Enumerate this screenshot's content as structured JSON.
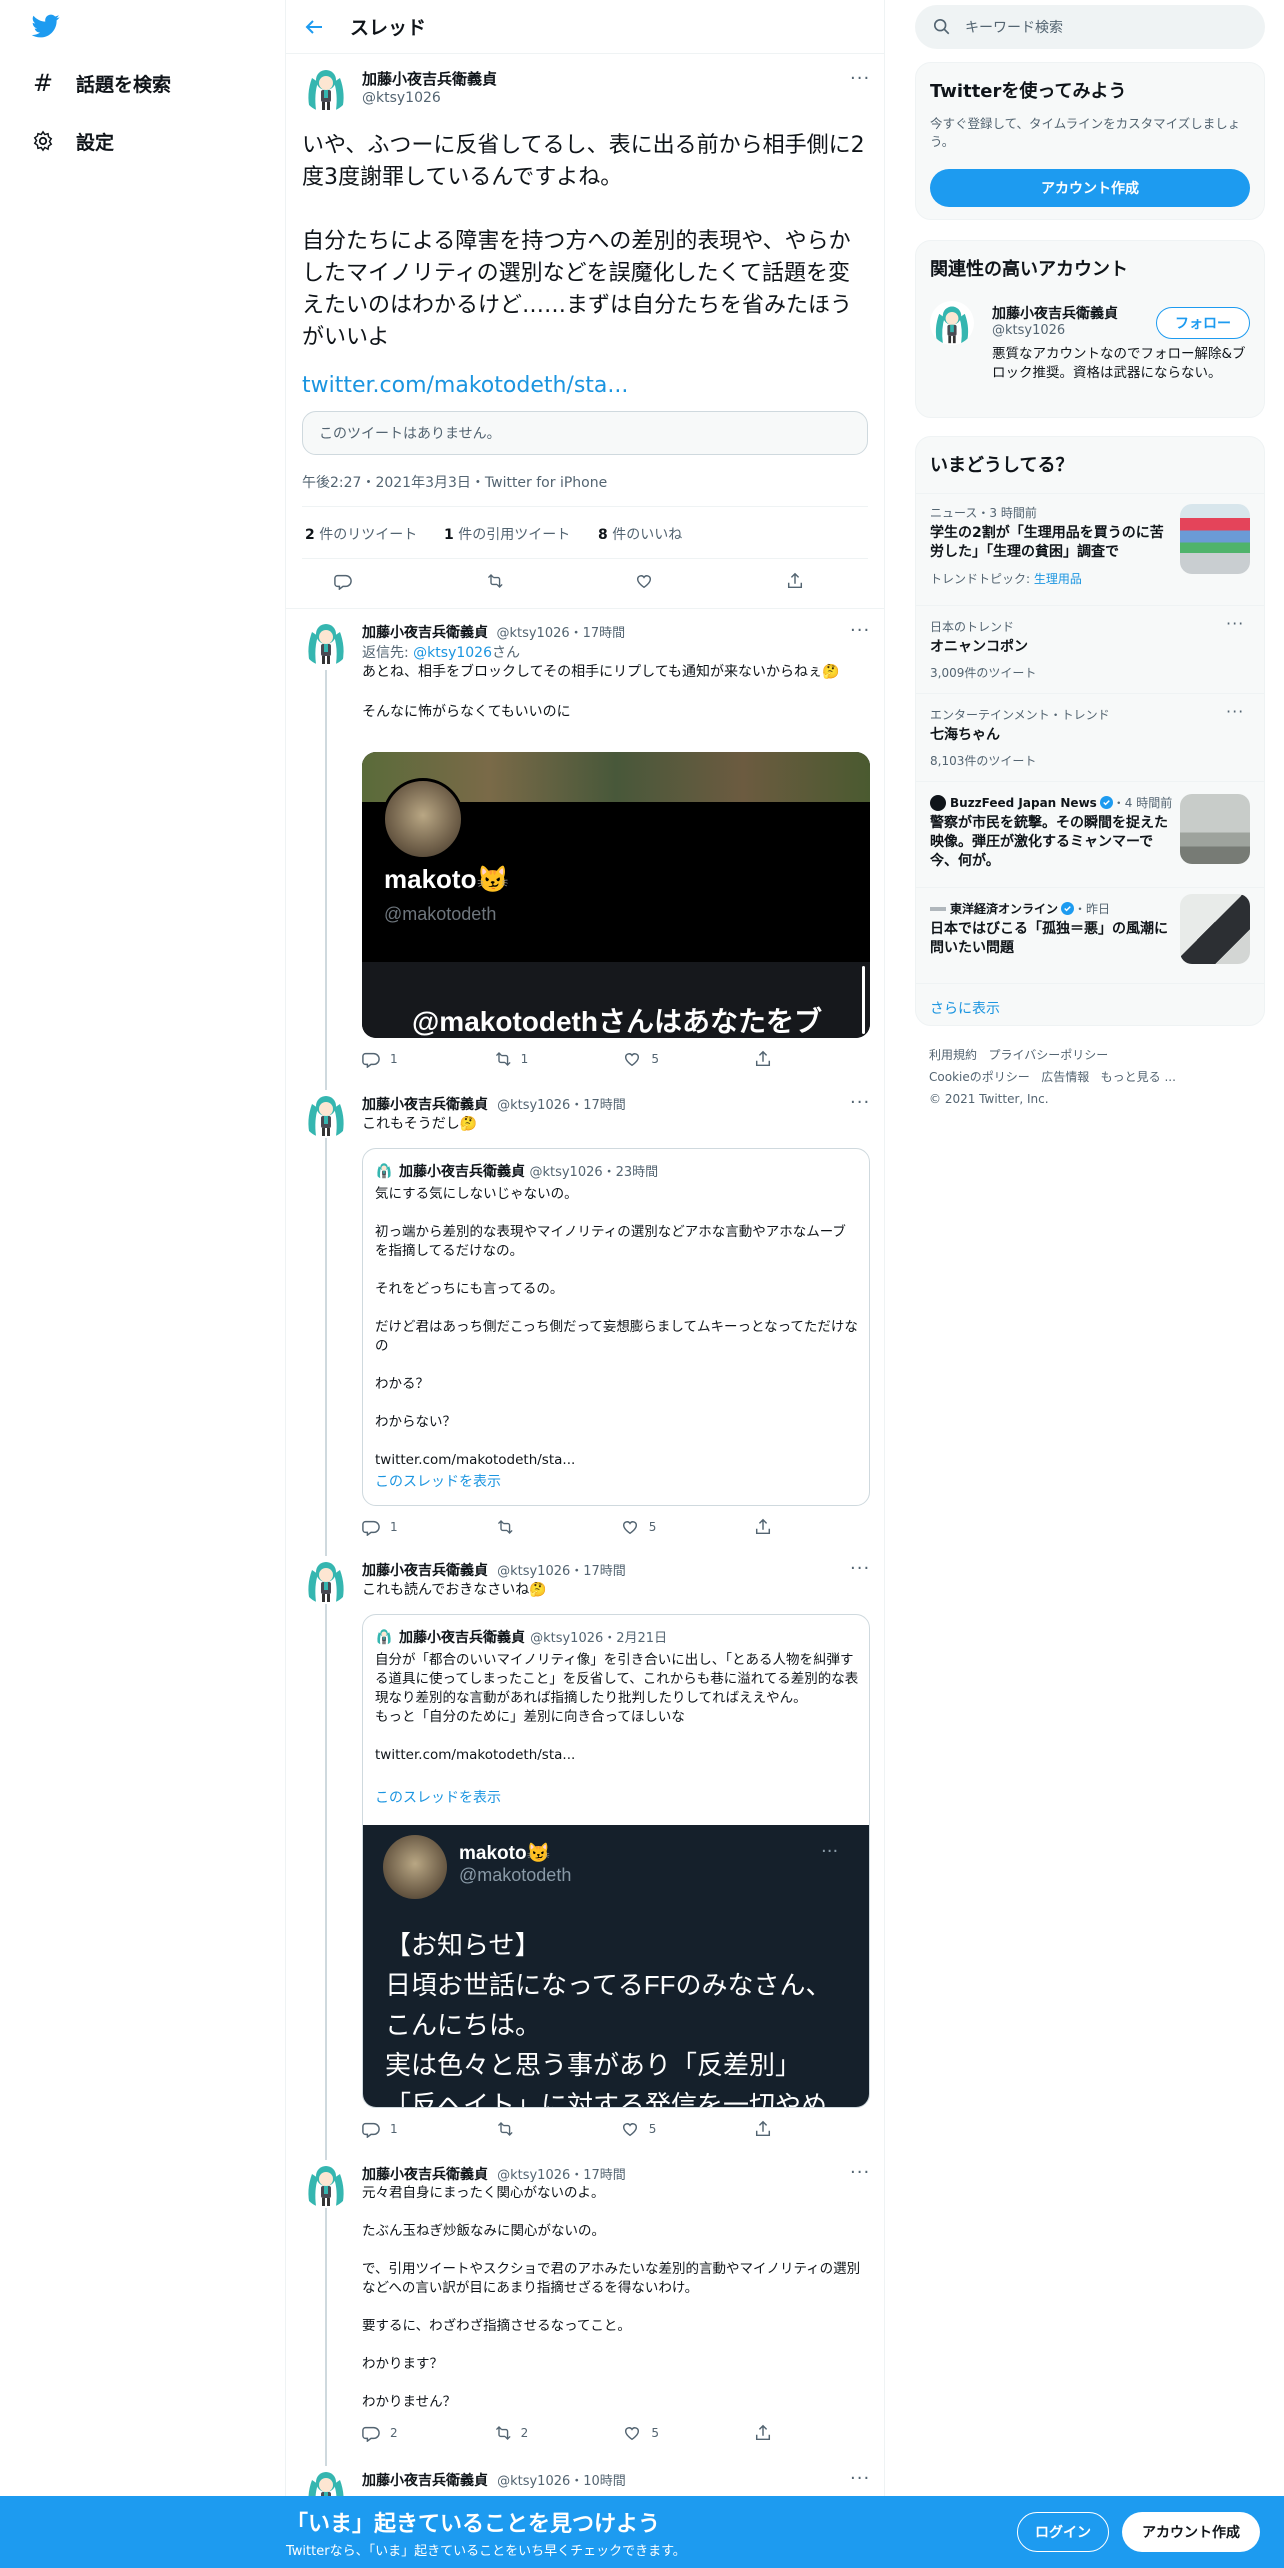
{
  "sidebar": {
    "explore_label": "話題を検索",
    "settings_label": "設定"
  },
  "header": {
    "title": "スレッド"
  },
  "main_tweet": {
    "name": "加藤小夜吉兵衛義貞",
    "handle": "@ktsy1026",
    "text": "いや、ふつーに反省してるし、表に出る前から相手側に2度3度謝罪しているんですよね。\n\n自分たちによる障害を持つ方への差別的表現や、やらかしたマイノリティの選別などを誤魔化したくて話題を変えたいのはわかるけど……まずは自分たちを省みたほうがいいよ",
    "link": "twitter.com/makotodeth/sta...",
    "unavailable": "このツイートはありません。",
    "meta": "午後2:27・2021年3月3日・Twitter for iPhone",
    "retweets_num": "2",
    "retweets_label": " 件のリツイート",
    "quotes_num": "1",
    "quotes_label": " 件の引用ツイート",
    "likes_num": "8",
    "likes_label": " 件のいいね"
  },
  "replies": [
    {
      "name": "加藤小夜吉兵衛義貞",
      "handle": "@ktsy1026・17時間",
      "reply_to_prefix": "返信先: ",
      "reply_to_handle": "@ktsy1026",
      "reply_to_suffix": "さん",
      "text": "あとね、相手をブロックしてその相手にリプしても通知が来ないからねぇ🤔\n\nそんなに怖がらなくてもいいのに",
      "media_name": "makoto😼",
      "media_handle": "@makotodeth",
      "media_banner": "@makotodethさんはあなたをブ",
      "replies": "1",
      "retweets": "1",
      "likes": "5"
    },
    {
      "name": "加藤小夜吉兵衛義貞",
      "handle": "@ktsy1026・17時間",
      "text": "これもそうだし🤔",
      "quote_name": "加藤小夜吉兵衛義貞",
      "quote_handle": "@ktsy1026・23時間",
      "quote_text": "気にする気にしないじゃないの。\n\n初っ端から差別的な表現やマイノリティの選別などアホな言動やアホなムーブを指摘してるだけなの。\n\nそれをどっちにも言ってるの。\n\nだけど君はあっち側だこっち側だって妄想膨らましてムキーっとなってただけなの\n\nわかる？\n\nわからない？\n\ntwitter.com/makotodeth/sta...",
      "quote_thread": "このスレッドを表示",
      "replies": "1",
      "retweets": "",
      "likes": "5"
    },
    {
      "name": "加藤小夜吉兵衛義貞",
      "handle": "@ktsy1026・17時間",
      "text": "これも読んでおきなさいね🤔",
      "quote_name": "加藤小夜吉兵衛義貞",
      "quote_handle": "@ktsy1026・2月21日",
      "quote_text": "自分が「都合のいいマイノリティ像」を引き合いに出し、「とある人物を糾弾する道具に使ってしまったこと」を反省して、これからも巷に溢れてる差別的な表現なり差別的な言動があれば指摘したり批判したりしてればええやん。\nもっと「自分のために」差別に向き合ってほしいな\n\ntwitter.com/makotodeth/sta...",
      "quote_thread": "このスレッドを表示",
      "media_name": "makoto😼",
      "media_handle": "@makotodeth",
      "media_text": "【お知らせ】\n日頃お世話になってるFFのみなさん、\nこんにちは。\n実は色々と思う事があり「反差別」\n「反ヘイト」に対する発信を一切やめ",
      "replies": "1",
      "retweets": "",
      "likes": "5"
    },
    {
      "name": "加藤小夜吉兵衛義貞",
      "handle": "@ktsy1026・17時間",
      "text": "元々君自身にまったく関心がないのよ。\n\nたぶん玉ねぎ炒飯なみに関心がないの。\n\nで、引用ツイートやスクショで君のアホみたいな差別的言動やマイノリティの選別などへの言い訳が目にあまり指摘せざるを得ないわけ。\n\n要するに、わざわざ指摘させるなってこと。\n\nわかります？\n\nわかりません？",
      "replies": "2",
      "retweets": "2",
      "likes": "5"
    },
    {
      "name": "加藤小夜吉兵衛義貞",
      "handle": "@ktsy1026・10時間"
    }
  ],
  "right": {
    "search_placeholder": "キーワード検索",
    "signup": {
      "title": "Twitterを使ってみよう",
      "desc": "今すぐ登録して、タイムラインをカスタマイズしましょう。",
      "button": "アカウント作成"
    },
    "related": {
      "title": "関連性の高いアカウント",
      "name": "加藤小夜吉兵衛義貞",
      "handle": "@ktsy1026",
      "follow": "フォロー",
      "bio": "悪質なアカウントなのでフォロー解除&ブロック推奨。資格は武器にならない。"
    },
    "trends": {
      "title": "いまどうしてる？",
      "items": [
        {
          "meta": "ニュース・3 時間前",
          "title": "学生の2割が「生理用品を買うのに苦労した」「生理の貧困」調査で",
          "extra_prefix": "トレンドトピック: ",
          "extra_topic": "生理用品"
        },
        {
          "meta": "日本のトレンド",
          "title": "オニャンコポン",
          "count": "3,009件のツイート"
        },
        {
          "meta": "エンターテインメント・トレンド",
          "title": "七海ちゃん",
          "count": "8,103件のツイート"
        },
        {
          "source": "BuzzFeed Japan News",
          "time": "・4 時間前",
          "title": "警察が市民を銃撃。その瞬間を捉えた映像。弾圧が激化するミャンマーで今、何が。"
        },
        {
          "source": "東洋経済オンライン",
          "time": "・昨日",
          "title": "日本ではびこる「孤独＝悪」の風潮に問いたい問題"
        }
      ],
      "more": "さらに表示"
    },
    "footer": {
      "terms": "利用規約",
      "privacy": "プライバシーポリシー",
      "cookie": "Cookieのポリシー",
      "ads": "広告情報",
      "more": "もっと見る ...",
      "copyright": "© 2021 Twitter, Inc."
    }
  },
  "bottom_bar": {
    "headline": "「いま」起きていることを見つけよう",
    "sub": "Twitterなら、「いま」起きていることをいち早くチェックできます。",
    "login": "ログイン",
    "signup": "アカウント作成"
  },
  "colors": {
    "accent": "#1d9bf0",
    "text": "#0f1419",
    "muted": "#536471"
  }
}
